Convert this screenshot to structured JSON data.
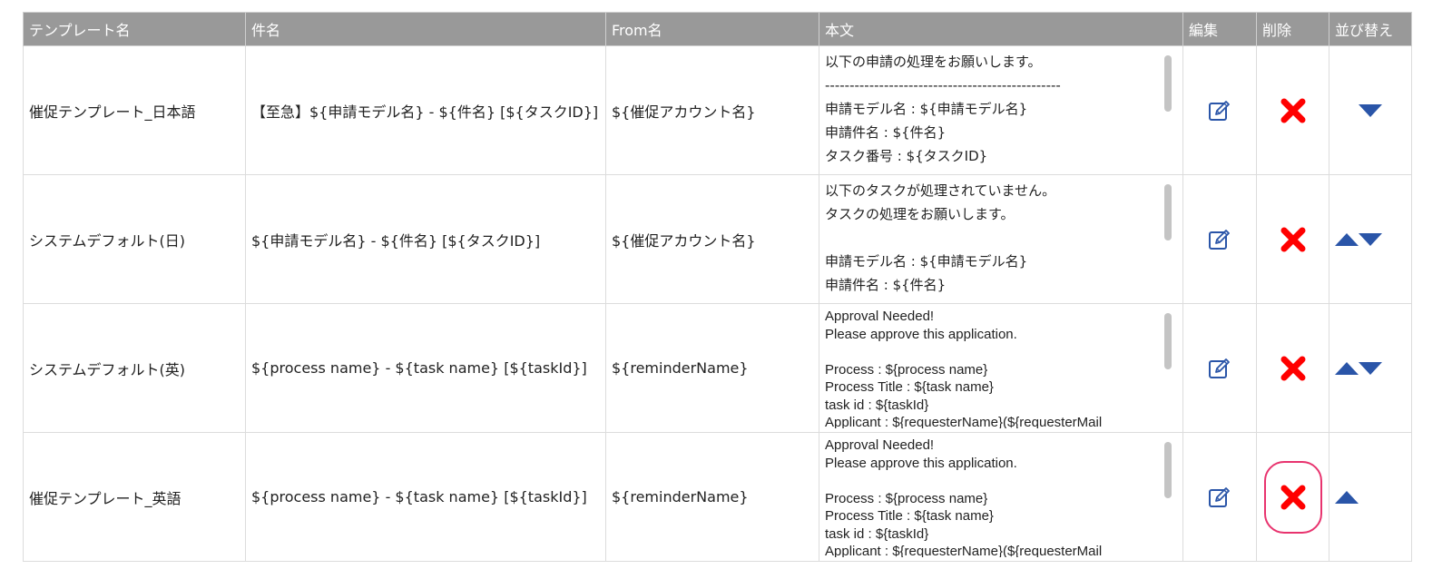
{
  "headers": {
    "name": "テンプレート名",
    "subject": "件名",
    "from": "From名",
    "body": "本文",
    "edit": "編集",
    "delete": "削除",
    "sort": "並び替え"
  },
  "rows": [
    {
      "name": "催促テンプレート_日本語",
      "subject": "【至急】${申請モデル名} - ${件名} [${タスクID}]",
      "from": "${催促アカウント名}",
      "body": "以下の申請の処理をお願いします。\n------------------------------------------------\n申請モデル名 : ${申請モデル名}\n申請件名 : ${件名}\nタスク番号 : ${タスクID}\n申請者 : ${申請者名}(${申請者メールアドレス})",
      "body_lang": "ja",
      "sort_up": false,
      "sort_down": true,
      "delete_highlighted": false
    },
    {
      "name": "システムデフォルト(日)",
      "subject": "${申請モデル名} - ${件名} [${タスクID}]",
      "from": "${催促アカウント名}",
      "body": "以下のタスクが処理されていません。\nタスクの処理をお願いします。\n\n申請モデル名 : ${申請モデル名}\n申請件名 : ${件名}\nタスク番号 : ${タスクID}",
      "body_lang": "ja",
      "sort_up": true,
      "sort_down": true,
      "delete_highlighted": false
    },
    {
      "name": "システムデフォルト(英)",
      "subject": "${process name} - ${task name} [${taskId}]",
      "from": "${reminderName}",
      "body": "Approval Needed!\nPlease approve this application.\n\nProcess : ${process name}\nProcess Title : ${task name}\ntask id : ${taskId}\nApplicant : ${requesterName}(${requesterMail",
      "body_lang": "en",
      "sort_up": true,
      "sort_down": true,
      "delete_highlighted": false
    },
    {
      "name": "催促テンプレート_英語",
      "subject": "${process name} - ${task name} [${taskId}]",
      "from": "${reminderName}",
      "body": "Approval Needed!\nPlease approve this application.\n\nProcess : ${process name}\nProcess Title : ${task name}\ntask id : ${taskId}\nApplicant : ${requesterName}(${requesterMail",
      "body_lang": "en",
      "sort_up": true,
      "sort_down": false,
      "delete_highlighted": true
    }
  ],
  "colors": {
    "header_bg": "#999999",
    "accent_blue": "#2a55a8",
    "delete_red": "#ff0000",
    "highlight": "#e8336e"
  },
  "icons": {
    "edit": "edit-icon",
    "delete": "delete-icon",
    "sort_up": "triangle-up-icon",
    "sort_down": "triangle-down-icon"
  }
}
